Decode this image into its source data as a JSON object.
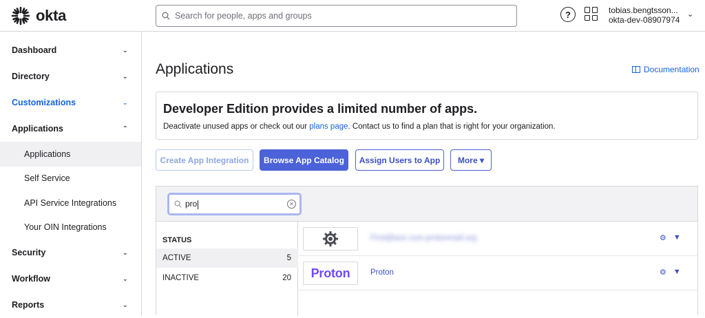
{
  "header": {
    "logo_text": "okta",
    "search_placeholder": "Search for people, apps and groups",
    "help_glyph": "?",
    "user_name": "tobias.bengtsson...",
    "org_name": "okta-dev-08907974"
  },
  "sidebar": {
    "items": [
      {
        "label": "Dashboard",
        "chevron": "down"
      },
      {
        "label": "Directory",
        "chevron": "down"
      },
      {
        "label": "Customizations",
        "chevron": "down",
        "highlight": true
      },
      {
        "label": "Applications",
        "chevron": "up"
      }
    ],
    "sub_items": [
      {
        "label": "Applications",
        "selected": true
      },
      {
        "label": "Self Service"
      },
      {
        "label": "API Service Integrations"
      },
      {
        "label": "Your OIN Integrations"
      }
    ],
    "bottom_items": [
      {
        "label": "Security"
      },
      {
        "label": "Workflow"
      },
      {
        "label": "Reports"
      }
    ]
  },
  "main": {
    "title": "Applications",
    "documentation_link": "Documentation",
    "banner": {
      "title": "Developer Edition provides a limited number of apps.",
      "text_before": "Deactivate unused apps or check out our ",
      "link": "plans page",
      "text_after": ". Contact us to find a plan that is right for your organization."
    },
    "buttons": {
      "create": "Create App Integration",
      "browse": "Browse App Catalog",
      "assign": "Assign Users to App",
      "more": "More ▾"
    },
    "filter": {
      "value": "pro"
    },
    "status": {
      "heading": "STATUS",
      "rows": [
        {
          "label": "ACTIVE",
          "count": "5"
        },
        {
          "label": "INACTIVE",
          "count": "20"
        }
      ]
    },
    "apps": [
      {
        "logo": "gear-icon",
        "name": "First@aze.com.protonmail.org",
        "blurred": true
      },
      {
        "logo_text": "Proton",
        "name": "Proton"
      }
    ]
  },
  "colors": {
    "accent": "#1662dd",
    "primary_button": "#4b62d8",
    "proton_purple": "#6d4aff"
  }
}
